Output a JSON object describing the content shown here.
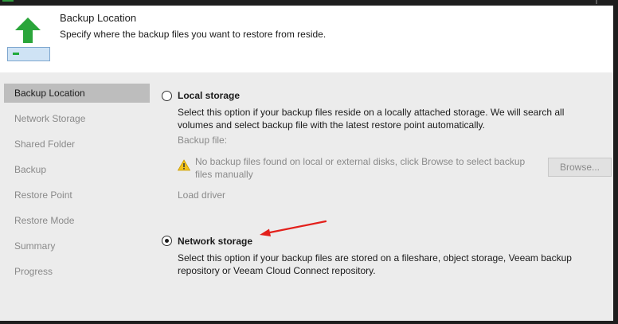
{
  "header": {
    "title": "Backup Location",
    "subtitle": "Specify where the backup files you want to restore from reside.",
    "icon": "green-up-arrow-icon"
  },
  "sidebar": {
    "items": [
      {
        "label": "Backup Location",
        "active": true
      },
      {
        "label": "Network Storage",
        "active": false
      },
      {
        "label": "Shared Folder",
        "active": false
      },
      {
        "label": "Backup",
        "active": false
      },
      {
        "label": "Restore Point",
        "active": false
      },
      {
        "label": "Restore Mode",
        "active": false
      },
      {
        "label": "Summary",
        "active": false
      },
      {
        "label": "Progress",
        "active": false
      }
    ]
  },
  "local": {
    "label": "Local storage",
    "selected": false,
    "description_line1": "Select this option if your backup files reside on a locally attached storage. We will search all",
    "description_line2": "volumes and select backup file with the latest restore point automatically.",
    "backup_file_label": "Backup file:",
    "warning_line1": "No backup files found on local or external disks, click Browse to select backup",
    "warning_line2": "files manually",
    "browse_label": "Browse...",
    "load_driver": "Load driver"
  },
  "network": {
    "label": "Network storage",
    "selected": true,
    "description_line1": "Select this option if your backup files are stored on a fileshare, object storage, Veeam backup",
    "description_line2": "repository or Veeam Cloud Connect repository."
  },
  "colors": {
    "arrow_annotation": "#e3201b",
    "accent_green": "#1faa3c",
    "sidebar_active": "#bdbdbd"
  }
}
